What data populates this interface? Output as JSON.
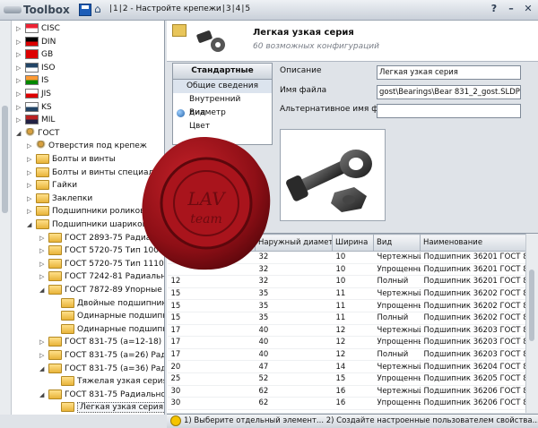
{
  "toolbar": {
    "app_name": "Toolbox",
    "steps": [
      "1",
      "2 - Настройте крепежи",
      "3",
      "4",
      "5"
    ]
  },
  "window_buttons": [
    "?",
    "–",
    "✕"
  ],
  "tree": [
    {
      "label": "CISC",
      "indent": 1,
      "icon": "flag",
      "colors": [
        "#e23",
        "#fff"
      ]
    },
    {
      "label": "DIN",
      "indent": 1,
      "icon": "flag",
      "colors": [
        "#000",
        "#d00"
      ]
    },
    {
      "label": "GB",
      "indent": 1,
      "icon": "flag",
      "colors": [
        "#d00",
        "#d00"
      ]
    },
    {
      "label": "ISO",
      "indent": 1,
      "icon": "flag",
      "colors": [
        "#246",
        "#fff"
      ]
    },
    {
      "label": "IS",
      "indent": 1,
      "icon": "flag",
      "colors": [
        "#f93",
        "#080"
      ]
    },
    {
      "label": "JIS",
      "indent": 1,
      "icon": "flag",
      "colors": [
        "#fff",
        "#d00"
      ]
    },
    {
      "label": "KS",
      "indent": 1,
      "icon": "flag",
      "colors": [
        "#fff",
        "#246"
      ]
    },
    {
      "label": "MIL",
      "indent": 1,
      "icon": "flag",
      "colors": [
        "#b22",
        "#224"
      ]
    },
    {
      "label": "ГОСТ",
      "indent": 1,
      "icon": "person"
    },
    {
      "label": "Отверстия под крепеж",
      "indent": 2,
      "icon": "person"
    },
    {
      "label": "Болты и винты",
      "indent": 2,
      "icon": "folder"
    },
    {
      "label": "Болты и винты специальные",
      "indent": 2,
      "icon": "folder"
    },
    {
      "label": "Гайки",
      "indent": 2,
      "icon": "folder"
    },
    {
      "label": "Заклепки",
      "indent": 2,
      "icon": "folder"
    },
    {
      "label": "Подшипники роликов",
      "indent": 2,
      "icon": "folder"
    },
    {
      "label": "Подшипники шариков",
      "indent": 2,
      "icon": "folder"
    },
    {
      "label": "ГОСТ 2893-75 Радиал",
      "indent": 3,
      "icon": "folder"
    },
    {
      "label": "ГОСТ 5720-75 Тип 1000",
      "indent": 3,
      "icon": "folder"
    },
    {
      "label": "ГОСТ 5720-75 Тип 11100",
      "indent": 3,
      "icon": "folder"
    },
    {
      "label": "ГОСТ 7242-81 Радиальны",
      "indent": 3,
      "icon": "folder"
    },
    {
      "label": "ГОСТ 7872-89 Упорные",
      "indent": 3,
      "icon": "folder"
    },
    {
      "label": "Двойные подшипники",
      "indent": 4,
      "icon": "folder"
    },
    {
      "label": "Одинарные подшипни",
      "indent": 4,
      "icon": "folder"
    },
    {
      "label": "Одинарные подшипни",
      "indent": 4,
      "icon": "folder"
    },
    {
      "label": "ГОСТ 831-75 (а=12-18) Ра",
      "indent": 3,
      "icon": "folder"
    },
    {
      "label": "ГОСТ 831-75 (а=26) Ради",
      "indent": 3,
      "icon": "folder"
    },
    {
      "label": "ГОСТ 831-75 (а=36) Ради",
      "indent": 3,
      "icon": "folder"
    },
    {
      "label": "Тяжелая узкая серия",
      "indent": 4,
      "icon": "folder"
    },
    {
      "label": "ГОСТ 831-75 Радиально у",
      "indent": 3,
      "icon": "folder"
    },
    {
      "label": "Легкая узкая серия",
      "indent": 4,
      "icon": "folder",
      "selected": true
    }
  ],
  "header": {
    "title": "Легкая узкая серия",
    "subtitle": "60 возможных конфигураций"
  },
  "props": {
    "heading": "Стандартные свойства",
    "items": [
      "Общие сведения",
      "Внутренний диаметр",
      "Вид",
      "Цвет"
    ]
  },
  "form": {
    "desc_label": "Описание",
    "desc_value": "Легкая узкая серия",
    "file_label": "Имя файла",
    "file_value": "gost\\Bearings\\Bear 831_2_gost.SLDPRT",
    "alt_label": "Альтернативное имя файла",
    "alt_value": ""
  },
  "table": {
    "columns": [
      "",
      "Наружный диаметр",
      "Ширина",
      "Вид",
      "Наименование"
    ],
    "rows": [
      [
        "",
        "32",
        "10",
        "Чертежный",
        "Подшипник 36201 ГОСТ 831-7"
      ],
      [
        "",
        "32",
        "10",
        "Упрощенный",
        "Подшипник 36201 ГОСТ 831-7"
      ],
      [
        "12",
        "32",
        "10",
        "Полный",
        "Подшипник 36201 ГОСТ 831-7"
      ],
      [
        "15",
        "35",
        "11",
        "Чертежный",
        "Подшипник 36202 ГОСТ 831-7"
      ],
      [
        "15",
        "35",
        "11",
        "Упрощенный",
        "Подшипник 36202 ГОСТ 831-7"
      ],
      [
        "15",
        "35",
        "11",
        "Полный",
        "Подшипник 36202 ГОСТ 831-7"
      ],
      [
        "17",
        "40",
        "12",
        "Чертежный",
        "Подшипник 36203 ГОСТ 831-7"
      ],
      [
        "17",
        "40",
        "12",
        "Упрощенный",
        "Подшипник 36203 ГОСТ 831-7"
      ],
      [
        "17",
        "40",
        "12",
        "Полный",
        "Подшипник 36203 ГОСТ 831-7"
      ],
      [
        "20",
        "47",
        "14",
        "Чертежный",
        "Подшипник 36204 ГОСТ 831-7"
      ],
      [
        "25",
        "52",
        "15",
        "Упрощенный",
        "Подшипник 36205 ГОСТ 831-7"
      ],
      [
        "30",
        "62",
        "16",
        "Чертежный",
        "Подшипник 36206 ГОСТ 831-7"
      ],
      [
        "30",
        "62",
        "16",
        "Упрощенный",
        "Подшипник 36206 ГОСТ 831-7"
      ]
    ]
  },
  "status": "1) Выберите отдельный элемент... 2) Создайте настроенные пользователем свойства... 3) Добавь",
  "seal": {
    "top": "LAV",
    "bottom": "team",
    "ring": "Xgsof LAV"
  }
}
